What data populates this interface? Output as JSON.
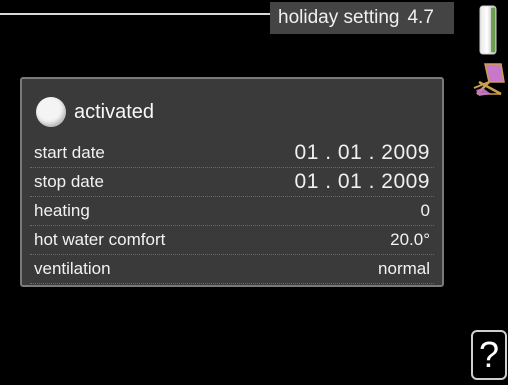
{
  "header": {
    "title": "holiday setting",
    "menu_number": "4.7"
  },
  "icons": {
    "status_bar": "status-bar-icon",
    "holiday": "deck-chair-icon",
    "help": "help-icon",
    "help_glyph": "?"
  },
  "panel": {
    "activated_label": "activated",
    "rows": [
      {
        "label": "start date",
        "value": "01 . 01 . 2009"
      },
      {
        "label": "stop date",
        "value": "01 . 01 . 2009"
      },
      {
        "label": "heating",
        "value": "0"
      },
      {
        "label": "hot water comfort",
        "value": "20.0°"
      },
      {
        "label": "ventilation",
        "value": "normal"
      }
    ]
  },
  "colors": {
    "background": "#000000",
    "panel": "#3a3a3a",
    "title_bar": "#444444",
    "accent_chair": "#c878c8"
  }
}
